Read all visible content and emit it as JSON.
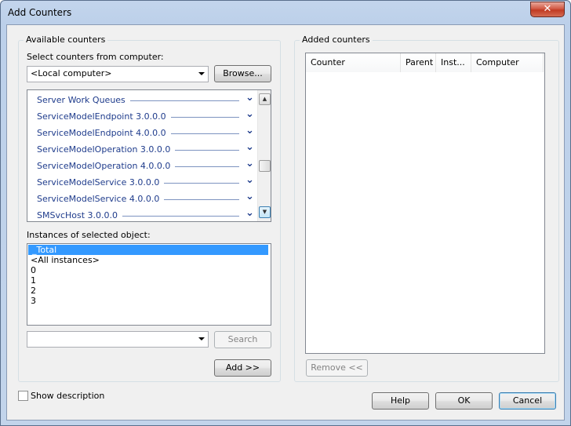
{
  "window": {
    "title": "Add Counters",
    "close_glyph": "✕"
  },
  "available": {
    "legend": "Available counters",
    "select_label": "Select counters from computer:",
    "computer_value": "<Local computer>",
    "browse_label": "Browse...",
    "counters": [
      "Server Work Queues",
      "ServiceModelEndpoint 3.0.0.0",
      "ServiceModelEndpoint 4.0.0.0",
      "ServiceModelOperation 3.0.0.0",
      "ServiceModelOperation 4.0.0.0",
      "ServiceModelService 3.0.0.0",
      "ServiceModelService 4.0.0.0",
      "SMSvcHost 3.0.0.0"
    ],
    "instances_label": "Instances of selected object:",
    "instances": [
      "_Total",
      "<All instances>",
      "0",
      "1",
      "2",
      "3"
    ],
    "selected_instance_index": 0,
    "search_value": "",
    "search_label": "Search",
    "add_label": "Add >>"
  },
  "added": {
    "legend": "Added counters",
    "columns": [
      "Counter",
      "Parent",
      "Inst...",
      "Computer"
    ],
    "remove_label": "Remove <<"
  },
  "footer": {
    "show_description_label": "Show description",
    "show_description_checked": false,
    "help_label": "Help",
    "ok_label": "OK",
    "cancel_label": "Cancel"
  }
}
